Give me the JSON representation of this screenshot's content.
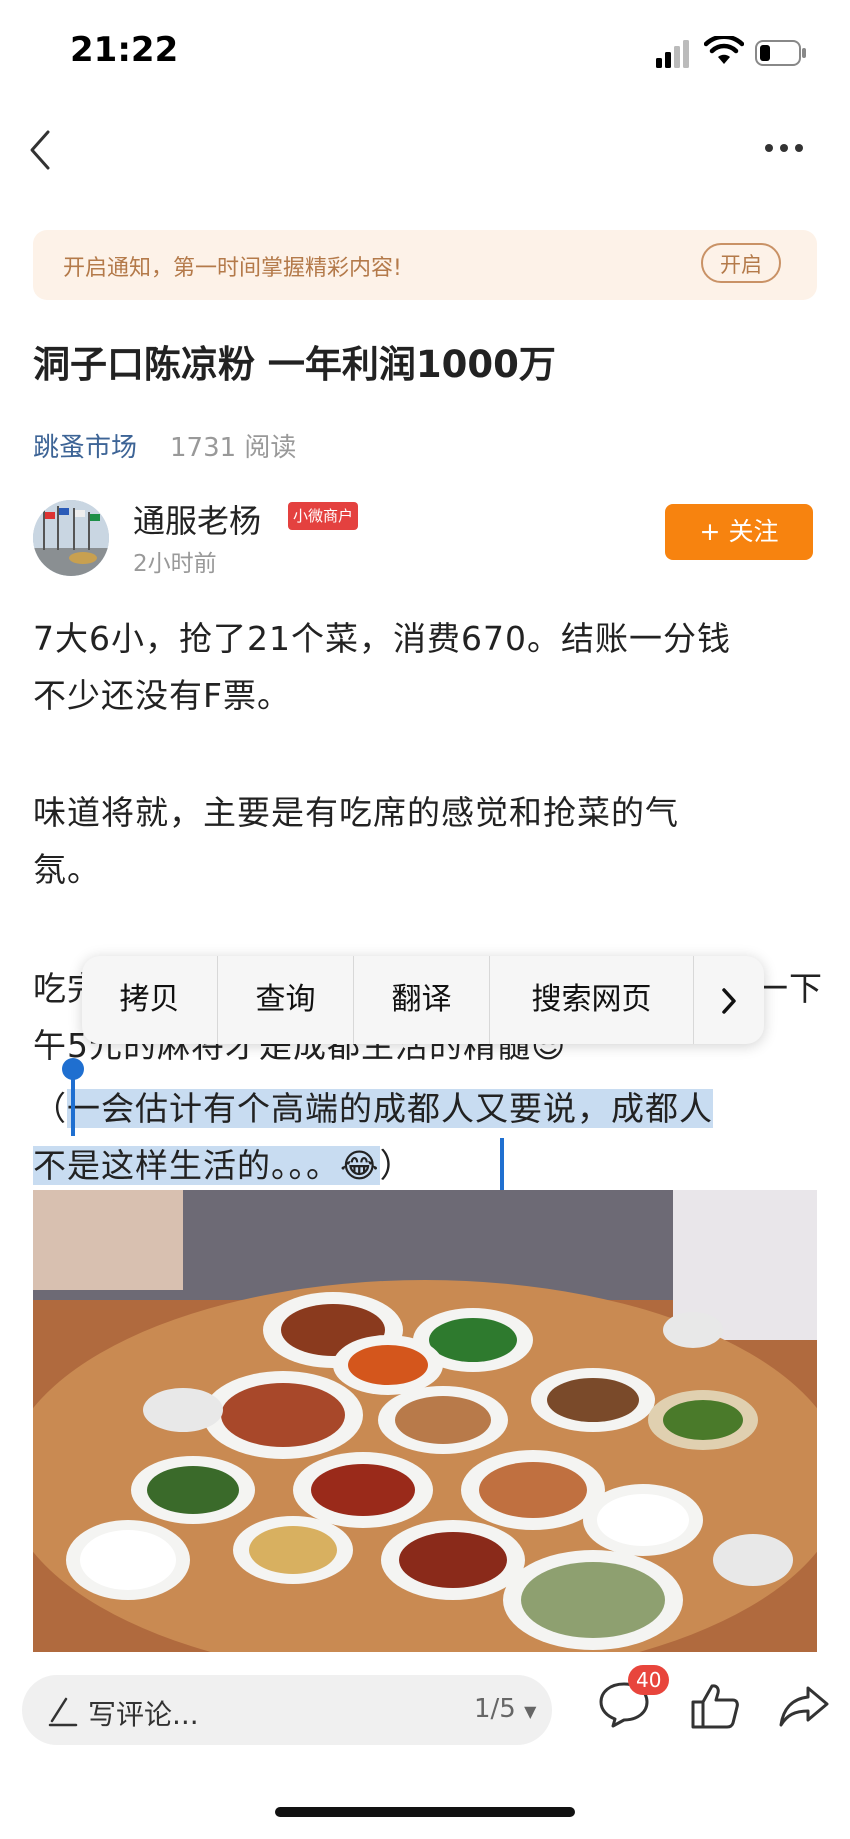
{
  "status_bar": {
    "time": "21:22"
  },
  "notify": {
    "text": "开启通知，第一时间掌握精彩内容!",
    "button": "开启"
  },
  "article": {
    "title": "洞子口陈凉粉 一年利润1000万",
    "source": "跳蚤市场",
    "reads": "1731 阅读"
  },
  "author": {
    "name": "通服老杨",
    "badge": "小微商户",
    "time": "2小时前",
    "follow_label": "+ 关注"
  },
  "body": {
    "p1_line1": "7大6小，抢了21个菜，消费670。结账一分钱",
    "p1_line2": "不少还没有F票。",
    "p2_line1": "味道将就，主要是有吃席的感觉和抢菜的气",
    "p2_line2": "氛。",
    "p3_line1_left": "吃完",
    "p3_line1_right": "一下",
    "p3_line2": "午5元的麻将才是成都生活的精髓😎",
    "p4_line1_start": "（",
    "p4_line1_selected": "一会估计有个高端的成都人又要说，成都人",
    "p4_line2_selected": "不是这样生活的。。。😂",
    "p4_line2_end": "）"
  },
  "context_menu": {
    "items": [
      "拷贝",
      "查询",
      "翻译",
      "搜索网页"
    ]
  },
  "bottom_bar": {
    "comment_placeholder": "写评论...",
    "page_indicator": "1/5",
    "comment_count": "40"
  },
  "icons": {
    "back": "back-arrow-icon",
    "more": "more-dots-icon",
    "comment": "comment-bubble-icon",
    "like": "thumbs-up-icon",
    "share": "share-arrow-icon",
    "edit": "pencil-icon"
  },
  "colors": {
    "accent": "#f7830f",
    "link": "#3d6496",
    "selection": "#c8dcf1",
    "handle": "#1f6fd0",
    "badge": "#e4413f"
  }
}
